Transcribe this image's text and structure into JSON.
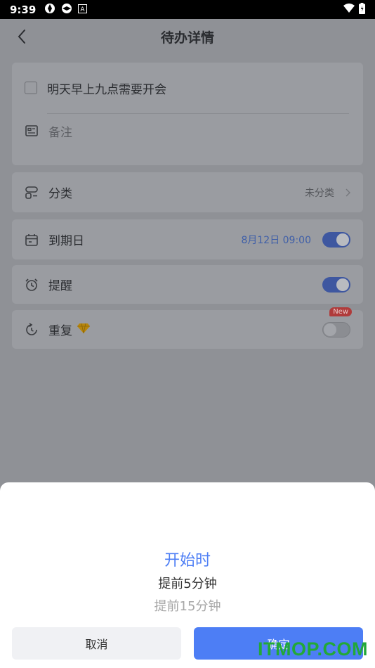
{
  "status": {
    "time": "9:39"
  },
  "header": {
    "title": "待办详情"
  },
  "todo": {
    "title": "明天早上九点需要开会",
    "note_placeholder": "备注"
  },
  "category": {
    "label": "分类",
    "value": "未分类"
  },
  "due": {
    "label": "到期日",
    "value": "8月12日 09:00",
    "enabled": true
  },
  "reminder": {
    "label": "提醒",
    "enabled": true
  },
  "repeat": {
    "label": "重复",
    "badge": "New",
    "enabled": false
  },
  "picker": {
    "options": [
      "开始时",
      "提前5分钟",
      "提前15分钟"
    ],
    "selected": "开始时"
  },
  "buttons": {
    "cancel": "取消",
    "confirm": "确定"
  },
  "watermark": "ITMOP.COM",
  "colors": {
    "accent": "#4d7ef5",
    "overlay_bg": "#8f9196",
    "badge": "#b03b3b"
  }
}
